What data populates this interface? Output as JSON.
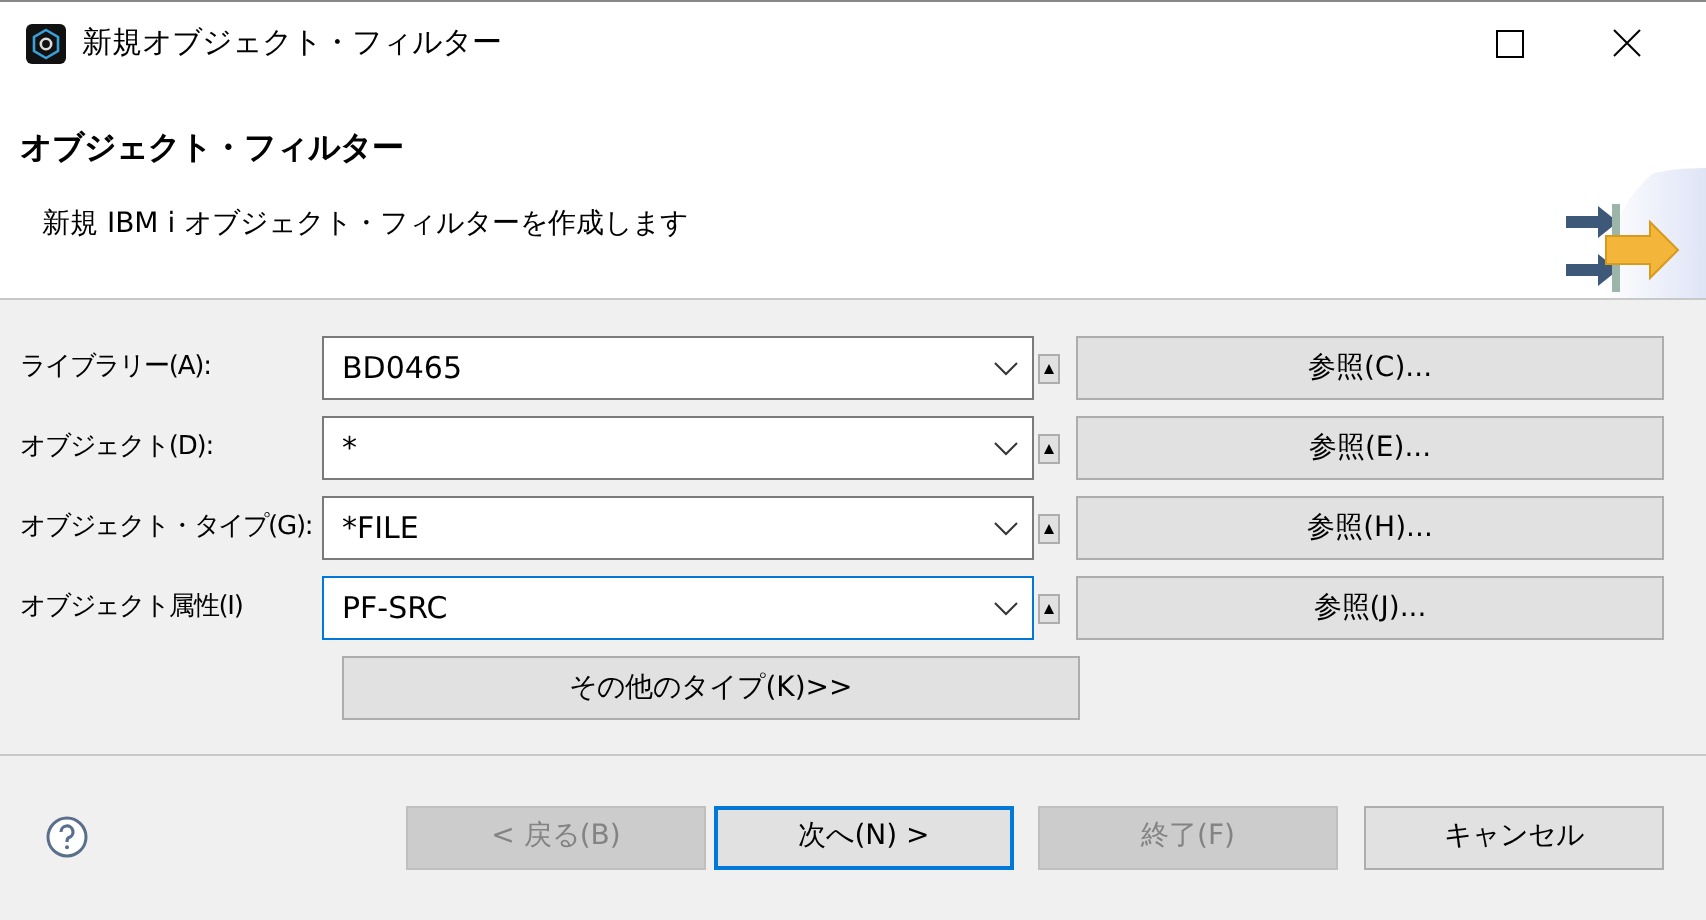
{
  "window": {
    "title": "新規オブジェクト・フィルター"
  },
  "header": {
    "title": "オブジェクト・フィルター",
    "description": "新規 IBM i オブジェクト・フィルターを作成します"
  },
  "fields": [
    {
      "label": "ライブラリー(A):",
      "value": "BD0465",
      "focused": false,
      "browse": "参照(C)..."
    },
    {
      "label": "オブジェクト(D):",
      "value": "*",
      "focused": false,
      "browse": "参照(E)..."
    },
    {
      "label": "オブジェクト・タイプ(G):",
      "value": "*FILE",
      "focused": false,
      "browse": "参照(H)..."
    },
    {
      "label": "オブジェクト属性(I)",
      "value": "PF-SRC",
      "focused": true,
      "browse": "参照(J)..."
    }
  ],
  "more_types_button": "その他のタイプ(K)>>",
  "buttons": [
    {
      "label": "< 戻る(B)",
      "disabled": true,
      "default": false
    },
    {
      "label": "次へ(N) >",
      "disabled": false,
      "default": true
    },
    {
      "label": "終了(F)",
      "disabled": true,
      "default": false
    },
    {
      "label": "キャンセル",
      "disabled": false,
      "default": false
    }
  ]
}
